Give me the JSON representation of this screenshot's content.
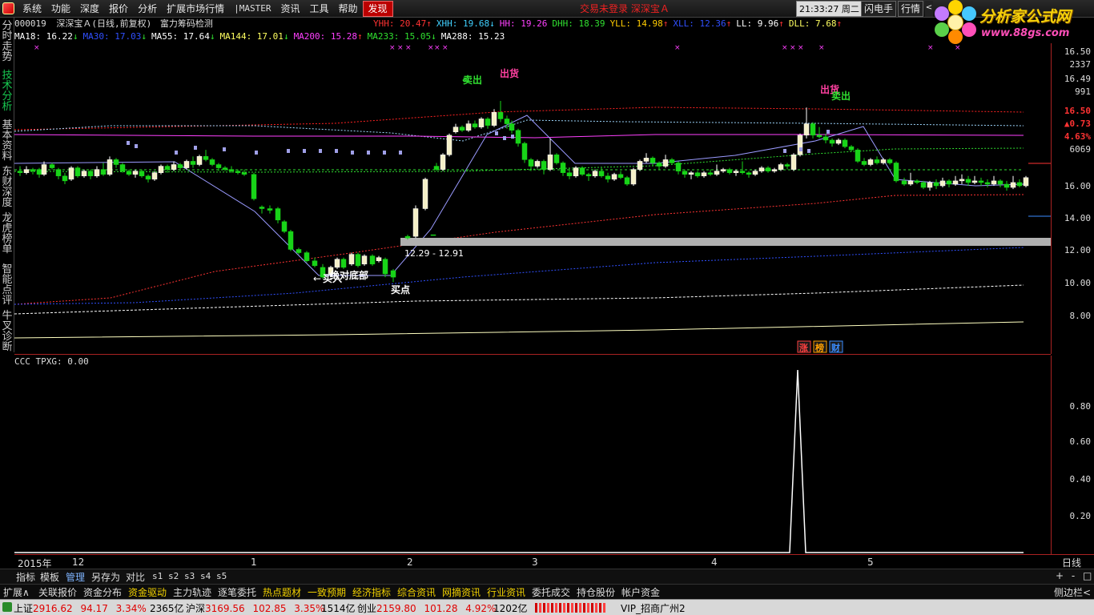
{
  "menu": {
    "items": [
      "系统",
      "功能",
      "深度",
      "报价",
      "分析",
      "扩展市场行情",
      "|MASTER",
      "资讯",
      "工具",
      "帮助",
      "发现"
    ],
    "status": "交易未登录   深深宝Ａ",
    "clock": "21:33:27 周二",
    "btn_shandian": "闪电手",
    "btn_hangqing": "行情",
    "btn_more": "<"
  },
  "watermark": {
    "title": "分析家公式网",
    "url": "www.88gs.com"
  },
  "left_tabs": [
    "分时走势",
    "技术分析",
    "基本资料",
    "东财深度",
    "龙虎榜单",
    "智能点评",
    "牛叉诊断"
  ],
  "stock": {
    "code": "000019",
    "name": "深深宝Ａ(日线,前复权)",
    "formula": "富力筹码检测"
  },
  "indicators_top": [
    {
      "text": "YHH: 20.47",
      "color": "#ff3333",
      "arrow": "↑",
      "arrow_color": "#ff3333"
    },
    {
      "text": "XHH: 19.68",
      "color": "#40d0ff",
      "arrow": "↓",
      "arrow_color": "#40d0ff"
    },
    {
      "text": "HH: 19.26",
      "color": "#ff40ff",
      "arrow": "",
      "arrow_color": ""
    },
    {
      "text": "DHH: 18.39",
      "color": "#30e030",
      "arrow": "",
      "arrow_color": ""
    },
    {
      "text": "YLL: 14.98",
      "color": "#ffcc00",
      "arrow": "↑",
      "arrow_color": "#ff3333"
    },
    {
      "text": "XLL: 12.36",
      "color": "#3050ff",
      "arrow": "↑",
      "arrow_color": "#ff3333"
    },
    {
      "text": "LL: 9.96",
      "color": "#ffffff",
      "arrow": "↑",
      "arrow_color": "#ff3333"
    },
    {
      "text": "DLL: 7.68",
      "color": "#ffff60",
      "arrow": "↑",
      "arrow_color": "#ff3333"
    }
  ],
  "indicators_ma": [
    {
      "text": "MA18: 16.22",
      "color": "#ffffff",
      "arrow": "↓",
      "arrow_color": "#30e030"
    },
    {
      "text": "MA30: 17.03",
      "color": "#3050ff",
      "arrow": "↓",
      "arrow_color": "#30e030"
    },
    {
      "text": "MA55: 17.64",
      "color": "#ffffff",
      "arrow": "↓",
      "arrow_color": "#30e030"
    },
    {
      "text": "MA144: 17.01",
      "color": "#ffff60",
      "arrow": "↓",
      "arrow_color": "#30e030"
    },
    {
      "text": "MA200: 15.28",
      "color": "#ff40ff",
      "arrow": "↑",
      "arrow_color": "#ff3333"
    },
    {
      "text": "MA233: 15.05",
      "color": "#30e030",
      "arrow": "↓",
      "arrow_color": "#30e030"
    },
    {
      "text": "MA288: 15.23",
      "color": "#ffffff",
      "arrow": "",
      "arrow_color": ""
    }
  ],
  "price_axis": {
    "ticks": [
      "16.50",
      "16.49",
      "16.00",
      "14.00",
      "12.00",
      "10.00",
      "8.00"
    ],
    "info": [
      "2337",
      "991",
      "16.50",
      "▲0.73",
      "4.63%",
      "6069"
    ]
  },
  "annotations": {
    "sell1": "卖出",
    "ship1": "出货",
    "ship2": "出货",
    "sell2": "卖出",
    "buy1": "买入",
    "bottom": "绝对底部",
    "buy_point": "买点",
    "range": "12.29 - 12.91",
    "mini_tags": [
      "涨",
      "榜",
      "财"
    ]
  },
  "sub": {
    "title": "CCC TPXG: 0.00",
    "ticks": [
      "0.80",
      "0.60",
      "0.40",
      "0.20"
    ]
  },
  "time_axis": {
    "labels": [
      "2015年",
      "12",
      "1",
      "2",
      "3",
      "4",
      "5"
    ],
    "period": "日线"
  },
  "tools": {
    "items": [
      "指标",
      "模板",
      "管理",
      "另存为",
      "对比"
    ],
    "slots": [
      "s1",
      "s2",
      "s3",
      "s4",
      "s5"
    ],
    "zoom": "+ - □"
  },
  "functions": {
    "items": [
      "扩展∧",
      "关联报价",
      "资金分布",
      "资金驱动",
      "主力轨迹",
      "逐笔委托",
      "热点题材",
      "一致预期",
      "经济指标",
      "综合资讯",
      "网摘资讯",
      "行业资讯",
      "委托成交",
      "持仓股份",
      "帐户资金"
    ],
    "side_toggle": "侧边栏<"
  },
  "ticker": {
    "items": [
      {
        "name": "上证",
        "price": "2916.62",
        "chg": "94.17",
        "pct": "3.34%",
        "vol": "2365亿"
      },
      {
        "name": "沪深",
        "price": "3169.56",
        "chg": "102.85",
        "pct": "3.35%",
        "vol": "1514亿"
      },
      {
        "name": "创业",
        "price": "2159.80",
        "chg": "101.28",
        "pct": "4.92%",
        "vol": "1202亿"
      }
    ],
    "vip": "VIP_招商广州2"
  },
  "colors": {
    "up": "#ff3333",
    "down": "#30e030",
    "bg": "#000000",
    "grid": "#aa2222"
  }
}
